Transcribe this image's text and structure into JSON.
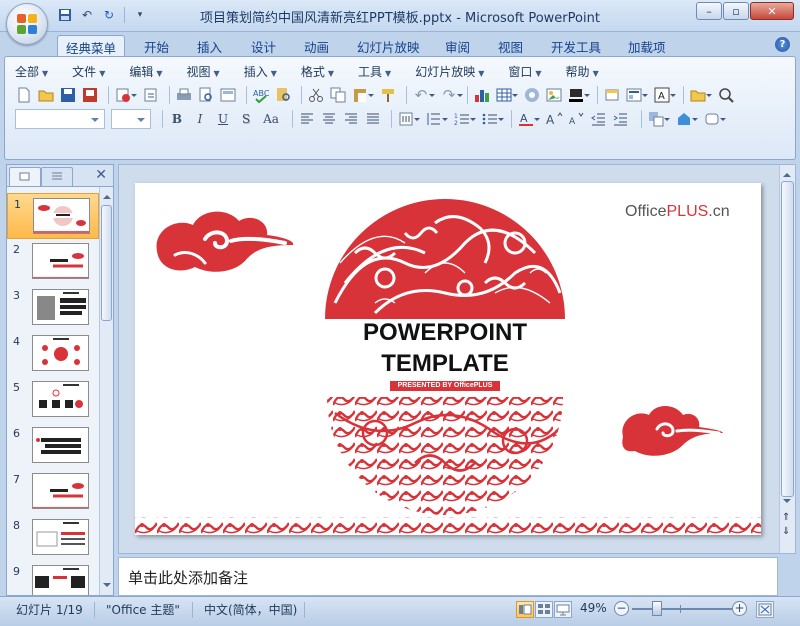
{
  "window": {
    "title": "项目策划简约中国风清新亮红PPT模板.pptx - Microsoft PowerPoint",
    "controls": [
      "–",
      "▫",
      "✕"
    ]
  },
  "ribbon_tabs": [
    {
      "label": "经典菜单",
      "active": true
    },
    {
      "label": "开始"
    },
    {
      "label": "插入"
    },
    {
      "label": "设计"
    },
    {
      "label": "动画"
    },
    {
      "label": "幻灯片放映"
    },
    {
      "label": "审阅"
    },
    {
      "label": "视图"
    },
    {
      "label": "开发工具"
    },
    {
      "label": "加载项"
    }
  ],
  "help_label": "?",
  "classic_menu": [
    "全部",
    "文件",
    "编辑",
    "视图",
    "插入",
    "格式",
    "工具",
    "幻灯片放映",
    "窗口",
    "帮助"
  ],
  "format_buttons": {
    "bold": "B",
    "italic": "I",
    "underline": "U",
    "shadow": "S",
    "case": "Aa"
  },
  "slide_thumbnails": [
    {
      "num": "1",
      "selected": true
    },
    {
      "num": "2"
    },
    {
      "num": "3"
    },
    {
      "num": "4"
    },
    {
      "num": "5"
    },
    {
      "num": "6"
    },
    {
      "num": "7"
    },
    {
      "num": "8"
    },
    {
      "num": "9"
    }
  ],
  "slide": {
    "brand_prefix": "Office",
    "brand_main": "PLUS",
    "brand_suffix": ".cn",
    "title_line1": "POWERPOINT",
    "title_line2": "TEMPLATE",
    "subtitle": "PRESENTED BY OfficePLUS"
  },
  "notes_placeholder": "单击此处添加备注",
  "status": {
    "slide_info": "幻灯片 1/19",
    "theme": "\"Office 主题\"",
    "language": "中文(简体，中国)",
    "zoom": "49%",
    "zoom_fraction": 0.49
  },
  "colors": {
    "accent_red": "#d9333a",
    "ribbon_blue": "#15428b",
    "selected_orange": "#ffb94a"
  }
}
